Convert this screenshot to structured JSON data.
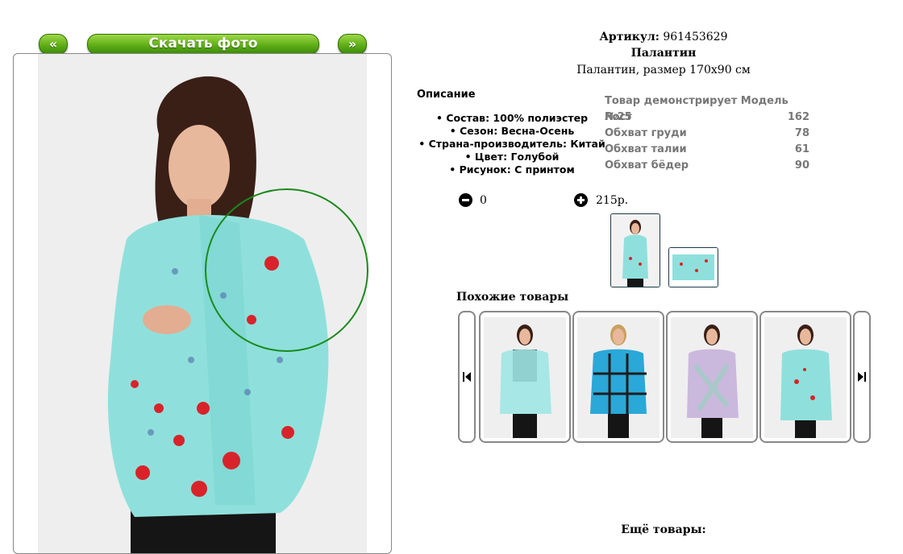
{
  "nav": {
    "prev_label": "«",
    "download_label": "Скачать фото",
    "next_label": "»"
  },
  "product": {
    "article_label": "Артикул:",
    "article_value": "961453629",
    "name": "Палантин",
    "subtitle": "Палантин, размер 170х90 см"
  },
  "description": {
    "heading": "Описание",
    "items": [
      "Состав: 100% полиэстер",
      "Сезон: Весна-Осень",
      "Страна-производитель: Китай",
      "Цвет: Голубой",
      "Рисунок: С принтом"
    ]
  },
  "model": {
    "title": "Товар демонстрирует Модель №25",
    "rows": [
      {
        "label": "Рост",
        "value": "162"
      },
      {
        "label": "Обхват груди",
        "value": "78"
      },
      {
        "label": "Обхват талии",
        "value": "61"
      },
      {
        "label": "Обхват бёдер",
        "value": "90"
      }
    ]
  },
  "purchase": {
    "quantity": "0",
    "price": "215р."
  },
  "similar": {
    "heading": "Похожие товары"
  },
  "more": {
    "heading": "Ещё товары:"
  },
  "colors": {
    "accent_green": "#5fae16",
    "scarf": "#8fe0dc",
    "flower": "#d8232a",
    "zoom_circle": "#1a8a1a"
  }
}
